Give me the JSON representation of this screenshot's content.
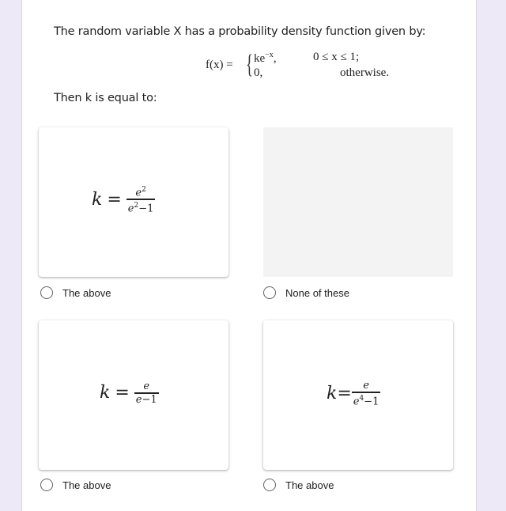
{
  "question": {
    "text": "The random variable X has a probability density function given by:",
    "formula": {
      "lhs": "f(x) =",
      "case1_expr_base": "ke",
      "case1_expr_exp": "−x",
      "case1_expr_tail": ",",
      "case1_cond": "0 ≤  x ≤ 1;",
      "case2_expr": "0,",
      "case2_cond": "otherwise."
    },
    "prompt": "Then k is equal to:"
  },
  "options": [
    {
      "label": "The above",
      "selected": false,
      "math": {
        "lhs": "k",
        "eq": "=",
        "num_base": "e",
        "num_sup": "2",
        "den_base": "e",
        "den_sup": "2",
        "den_tail": "−1"
      }
    },
    {
      "label": "None of these",
      "selected": false,
      "math": null
    },
    {
      "label": "The above",
      "selected": false,
      "math": {
        "lhs": "k",
        "eq": "=",
        "num_base": "e",
        "num_sup": "",
        "den_base": "e",
        "den_sup": "",
        "den_tail": "−1"
      }
    },
    {
      "label": "The above",
      "selected": false,
      "math": {
        "lhs": "k",
        "eq": "=",
        "num_base": "e",
        "num_sup": "",
        "den_base": "e",
        "den_sup": "4",
        "den_tail": "−1"
      }
    }
  ]
}
